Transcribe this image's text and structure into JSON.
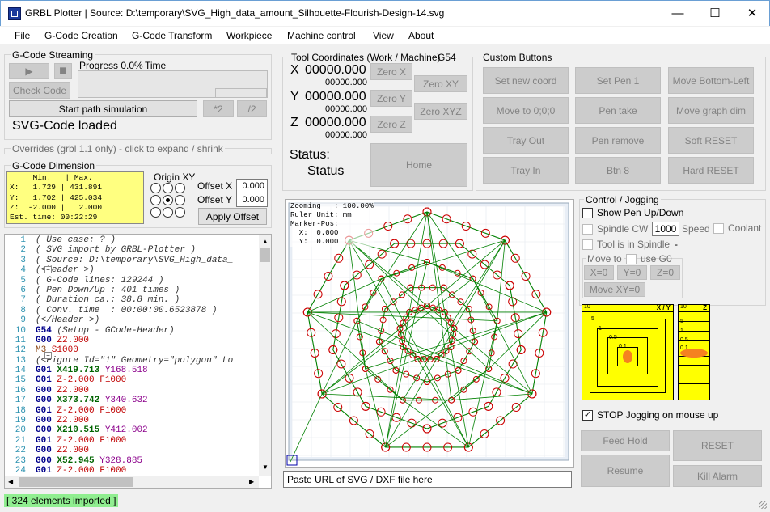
{
  "window": {
    "title": "GRBL Plotter | Source: D:\\temporary\\SVG_High_data_amount_Silhouette-Flourish-Design-14.svg",
    "minimize": "—",
    "maximize": "☐",
    "close": "✕"
  },
  "menu": [
    "File",
    "G-Code Creation",
    "G-Code Transform",
    "Workpiece",
    "Machine control",
    "View",
    "About"
  ],
  "streaming": {
    "title": "G-Code Streaming",
    "progress": "Progress 0.0%",
    "time": "Time",
    "play": "▶",
    "stop": "■",
    "check_code": "Check Code",
    "start_sim": "Start path simulation",
    "half": "*2",
    "div2": "/2",
    "status": "SVG-Code loaded"
  },
  "overrides": "Overrides (grbl 1.1 only) - click to expand / shrink",
  "dimension": {
    "title": "G-Code Dimension",
    "text": "     Min.   | Max.\nX:   1.729 | 431.891\nY:   1.702 | 425.034\nZ:  -2.000 |   2.000\nEst. time: 00:22:29",
    "origin_title": "Origin XY",
    "offset_x_label": "Offset X",
    "offset_y_label": "Offset Y",
    "offset_x": "0.000",
    "offset_y": "0.000",
    "apply": "Apply Offset"
  },
  "code_lines": [
    {
      "n": "1",
      "parts": [
        [
          "c-cmt",
          "( Use case: ? )"
        ]
      ]
    },
    {
      "n": "2",
      "parts": [
        [
          "c-cmt",
          "( SVG import by GRBL-Plotter )"
        ]
      ]
    },
    {
      "n": "3",
      "parts": [
        [
          "c-cmt",
          "( Source: D:\\temporary\\SVG_High_data_"
        ]
      ]
    },
    {
      "n": "4",
      "parts": [
        [
          "c-cmt",
          "(<Header >)"
        ]
      ]
    },
    {
      "n": "5",
      "parts": [
        [
          "c-cmt",
          "( G-Code lines: 129244 )"
        ]
      ]
    },
    {
      "n": "6",
      "parts": [
        [
          "c-cmt",
          "( Pen Down/Up : 401 times )"
        ]
      ]
    },
    {
      "n": "7",
      "parts": [
        [
          "c-cmt",
          "( Duration ca.: 38.8 min. )"
        ]
      ]
    },
    {
      "n": "8",
      "parts": [
        [
          "c-cmt",
          "( Conv. time  : 00:00:00.6523878 )"
        ]
      ]
    },
    {
      "n": "9",
      "parts": [
        [
          "c-cmt",
          "(</Header >)"
        ]
      ]
    },
    {
      "n": "10",
      "parts": [
        [
          "c-g",
          "G54"
        ],
        [
          "c-cmt",
          " (Setup - GCode-Header)"
        ]
      ]
    },
    {
      "n": "11",
      "parts": [
        [
          "c-g",
          "G00"
        ],
        [
          "c-z",
          " Z2.000"
        ]
      ]
    },
    {
      "n": "12",
      "parts": [
        [
          "c-m",
          "M3"
        ],
        [
          "c-f",
          " S1000"
        ]
      ]
    },
    {
      "n": "13",
      "parts": [
        [
          "c-cmt",
          "(<Figure Id=\"1\" Geometry=\"polygon\" Lo"
        ]
      ]
    },
    {
      "n": "14",
      "parts": [
        [
          "c-g",
          "G01"
        ],
        [
          "c-x",
          " X419.713"
        ],
        [
          "c-y",
          " Y168.518"
        ]
      ]
    },
    {
      "n": "15",
      "parts": [
        [
          "c-g",
          "G01"
        ],
        [
          "c-z",
          " Z-2.000"
        ],
        [
          "c-f",
          " F1000"
        ]
      ]
    },
    {
      "n": "16",
      "parts": [
        [
          "c-g",
          "G00"
        ],
        [
          "c-z",
          " Z2.000"
        ]
      ]
    },
    {
      "n": "17",
      "parts": [
        [
          "c-g",
          "G00"
        ],
        [
          "c-x",
          " X373.742"
        ],
        [
          "c-y",
          " Y340.632"
        ]
      ]
    },
    {
      "n": "18",
      "parts": [
        [
          "c-g",
          "G01"
        ],
        [
          "c-z",
          " Z-2.000"
        ],
        [
          "c-f",
          " F1000"
        ]
      ]
    },
    {
      "n": "19",
      "parts": [
        [
          "c-g",
          "G00"
        ],
        [
          "c-z",
          " Z2.000"
        ]
      ]
    },
    {
      "n": "20",
      "parts": [
        [
          "c-g",
          "G00"
        ],
        [
          "c-x",
          " X210.515"
        ],
        [
          "c-y",
          " Y412.002"
        ]
      ]
    },
    {
      "n": "21",
      "parts": [
        [
          "c-g",
          "G01"
        ],
        [
          "c-z",
          " Z-2.000"
        ],
        [
          "c-f",
          " F1000"
        ]
      ]
    },
    {
      "n": "22",
      "parts": [
        [
          "c-g",
          "G00"
        ],
        [
          "c-z",
          " Z2.000"
        ]
      ]
    },
    {
      "n": "23",
      "parts": [
        [
          "c-g",
          "G00"
        ],
        [
          "c-x",
          " X52.945"
        ],
        [
          "c-y",
          " Y328.885"
        ]
      ]
    },
    {
      "n": "24",
      "parts": [
        [
          "c-g",
          "G01"
        ],
        [
          "c-z",
          " Z-2.000"
        ],
        [
          "c-f",
          " F1000"
        ]
      ]
    },
    {
      "n": "25",
      "parts": [
        [
          "c-g",
          "G00"
        ],
        [
          "c-z",
          " Z2.000"
        ]
      ]
    }
  ],
  "tool": {
    "title": "Tool Coordinates (Work / Machine)",
    "g54": "G54",
    "x_label": "X",
    "y_label": "Y",
    "z_label": "Z",
    "x_work": "00000.000",
    "x_machine": "00000.000",
    "y_work": "00000.000",
    "y_machine": "00000.000",
    "z_work": "00000.000",
    "z_machine": "00000.000",
    "zero_x": "Zero X",
    "zero_y": "Zero Y",
    "zero_z": "Zero Z",
    "zero_xy": "Zero XY",
    "zero_xyz": "Zero XYZ",
    "status_label": "Status:",
    "status_value": "Status",
    "home": "Home"
  },
  "custom": {
    "title": "Custom Buttons",
    "buttons": [
      "Set new coord",
      "Set Pen 1",
      "Move Bottom-Left",
      "Move to 0;0;0",
      "Pen take",
      "Move graph dim",
      "Tray Out",
      "Pen remove",
      "Soft RESET",
      "Tray In",
      "Btn 8",
      "Hard RESET"
    ]
  },
  "preview": {
    "info": "Zooming   : 100.00%\nRuler Unit: mm\nMarker-Pos:\n  X:  0.000\n  Y:  0.000",
    "url_placeholder": "Paste URL of SVG / DXF file here"
  },
  "control": {
    "title": "Control / Jogging",
    "show_pen": "Show Pen Up/Down",
    "spindle_cw": "Spindle CW",
    "speed_value": "1000",
    "speed_label": "Speed",
    "coolant": "Coolant",
    "tool_in_spindle": "Tool is in Spindle",
    "tool_dash": "-",
    "move_to": "Move to",
    "use_g0": "use G0",
    "x0": "X=0",
    "y0": "Y=0",
    "z0": "Z=0",
    "move_xy0": "Move XY=0",
    "jog_xy_label": "X / Y",
    "jog_z_label": "Z",
    "jog_steps": [
      "10",
      "5",
      "1",
      "0.5",
      "0.1"
    ],
    "jog_z_steps": [
      "10",
      "5",
      "1",
      "0.5",
      "0.1"
    ],
    "stop_jogging": "STOP Jogging on mouse up",
    "feed_hold": "Feed Hold",
    "reset": "RESET",
    "resume": "Resume",
    "kill_alarm": "Kill Alarm"
  },
  "status_bar": "[ 324 elements imported ]",
  "colors": {
    "status_green": "#90ee90",
    "dim_yellow": "#ffff80",
    "jog_yellow": "#ffff00",
    "path_green": "#008000",
    "path_red": "#cc0000"
  }
}
